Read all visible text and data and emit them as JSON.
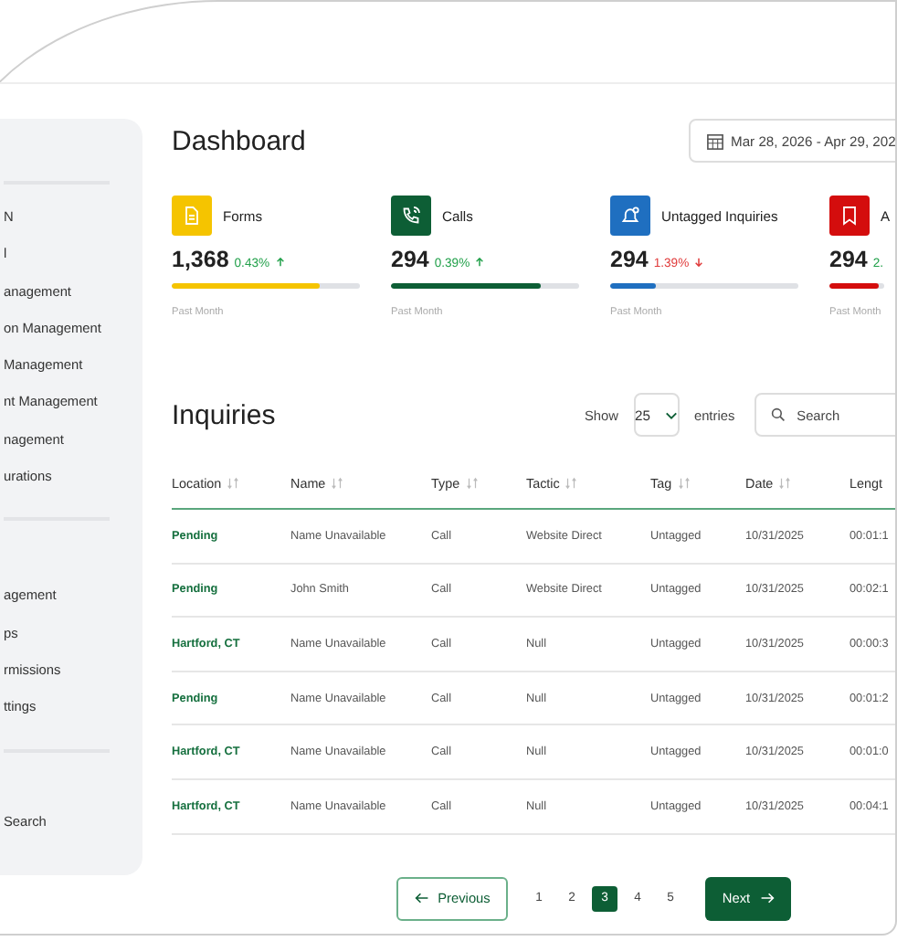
{
  "sidebar": {
    "groups": [
      {
        "items": [
          {
            "label": "N"
          },
          {
            "label": "l"
          },
          {
            "label": "anagement"
          },
          {
            "label": "on Management"
          },
          {
            "label": "Management"
          },
          {
            "label": "nt Management"
          },
          {
            "label": "nagement"
          },
          {
            "label": "urations"
          }
        ]
      },
      {
        "items": [
          {
            "label": "agement"
          },
          {
            "label": "ps"
          },
          {
            "label": "rmissions"
          },
          {
            "label": "ttings"
          }
        ]
      },
      {
        "items": [
          {
            "label": "Search"
          }
        ]
      }
    ]
  },
  "title": "Dashboard",
  "date_range": "Mar 28, 2026 - Apr 29, 202",
  "cards": [
    {
      "label": "Forms",
      "color": "#f5c400",
      "value": "1,368",
      "change": "0.43%",
      "kind": "rise",
      "level": 0.79,
      "period": "Past Month"
    },
    {
      "label": "Calls",
      "color": "#0d5e35",
      "value": "294",
      "change": "0.39%",
      "kind": "rise",
      "level": 0.8,
      "period": "Past Month"
    },
    {
      "label": "Untagged Inquiries",
      "color": "#1f6fc0",
      "value": "294",
      "change": "1.39%",
      "kind": "fall",
      "level": 0.24,
      "period": "Past Month"
    },
    {
      "label": "A",
      "color": "#d40d0d",
      "value": "294",
      "change": "2.",
      "kind": "rise",
      "level": 0.9,
      "period": "Past Month"
    }
  ],
  "inquiries": {
    "title": "Inquiries",
    "show_label": "Show",
    "page_size": "25",
    "entries_label": "entries",
    "search": {
      "placeholder": "Search"
    },
    "columns": [
      "Location",
      "Name",
      "Type",
      "Tactic",
      "Tag",
      "Date",
      "Lengt"
    ],
    "rows": [
      [
        "Pending",
        "Name Unavailable",
        "Call",
        "Website Direct",
        "Untagged",
        "10/31/2025",
        "00:01:1"
      ],
      [
        "Pending",
        "John Smith",
        "Call",
        "Website Direct",
        "Untagged",
        "10/31/2025",
        "00:02:1"
      ],
      [
        "Hartford, CT",
        "Name Unavailable",
        "Call",
        "Null",
        "Untagged",
        "10/31/2025",
        "00:00:3"
      ],
      [
        "Pending",
        "Name Unavailable",
        "Call",
        "Null",
        "Untagged",
        "10/31/2025",
        "00:01:2"
      ],
      [
        "Hartford, CT",
        "Name Unavailable",
        "Call",
        "Null",
        "Untagged",
        "10/31/2025",
        "00:01:0"
      ],
      [
        "Hartford, CT",
        "Name Unavailable",
        "Call",
        "Null",
        "Untagged",
        "10/31/2025",
        "00:04:1"
      ]
    ]
  },
  "pagination": {
    "previous": "Previous",
    "next": "Next",
    "pages": [
      {
        "label": "1",
        "selected": false
      },
      {
        "label": "2",
        "selected": false
      },
      {
        "label": "3",
        "selected": true
      },
      {
        "label": "4",
        "selected": false
      },
      {
        "label": "5",
        "selected": false
      }
    ]
  }
}
